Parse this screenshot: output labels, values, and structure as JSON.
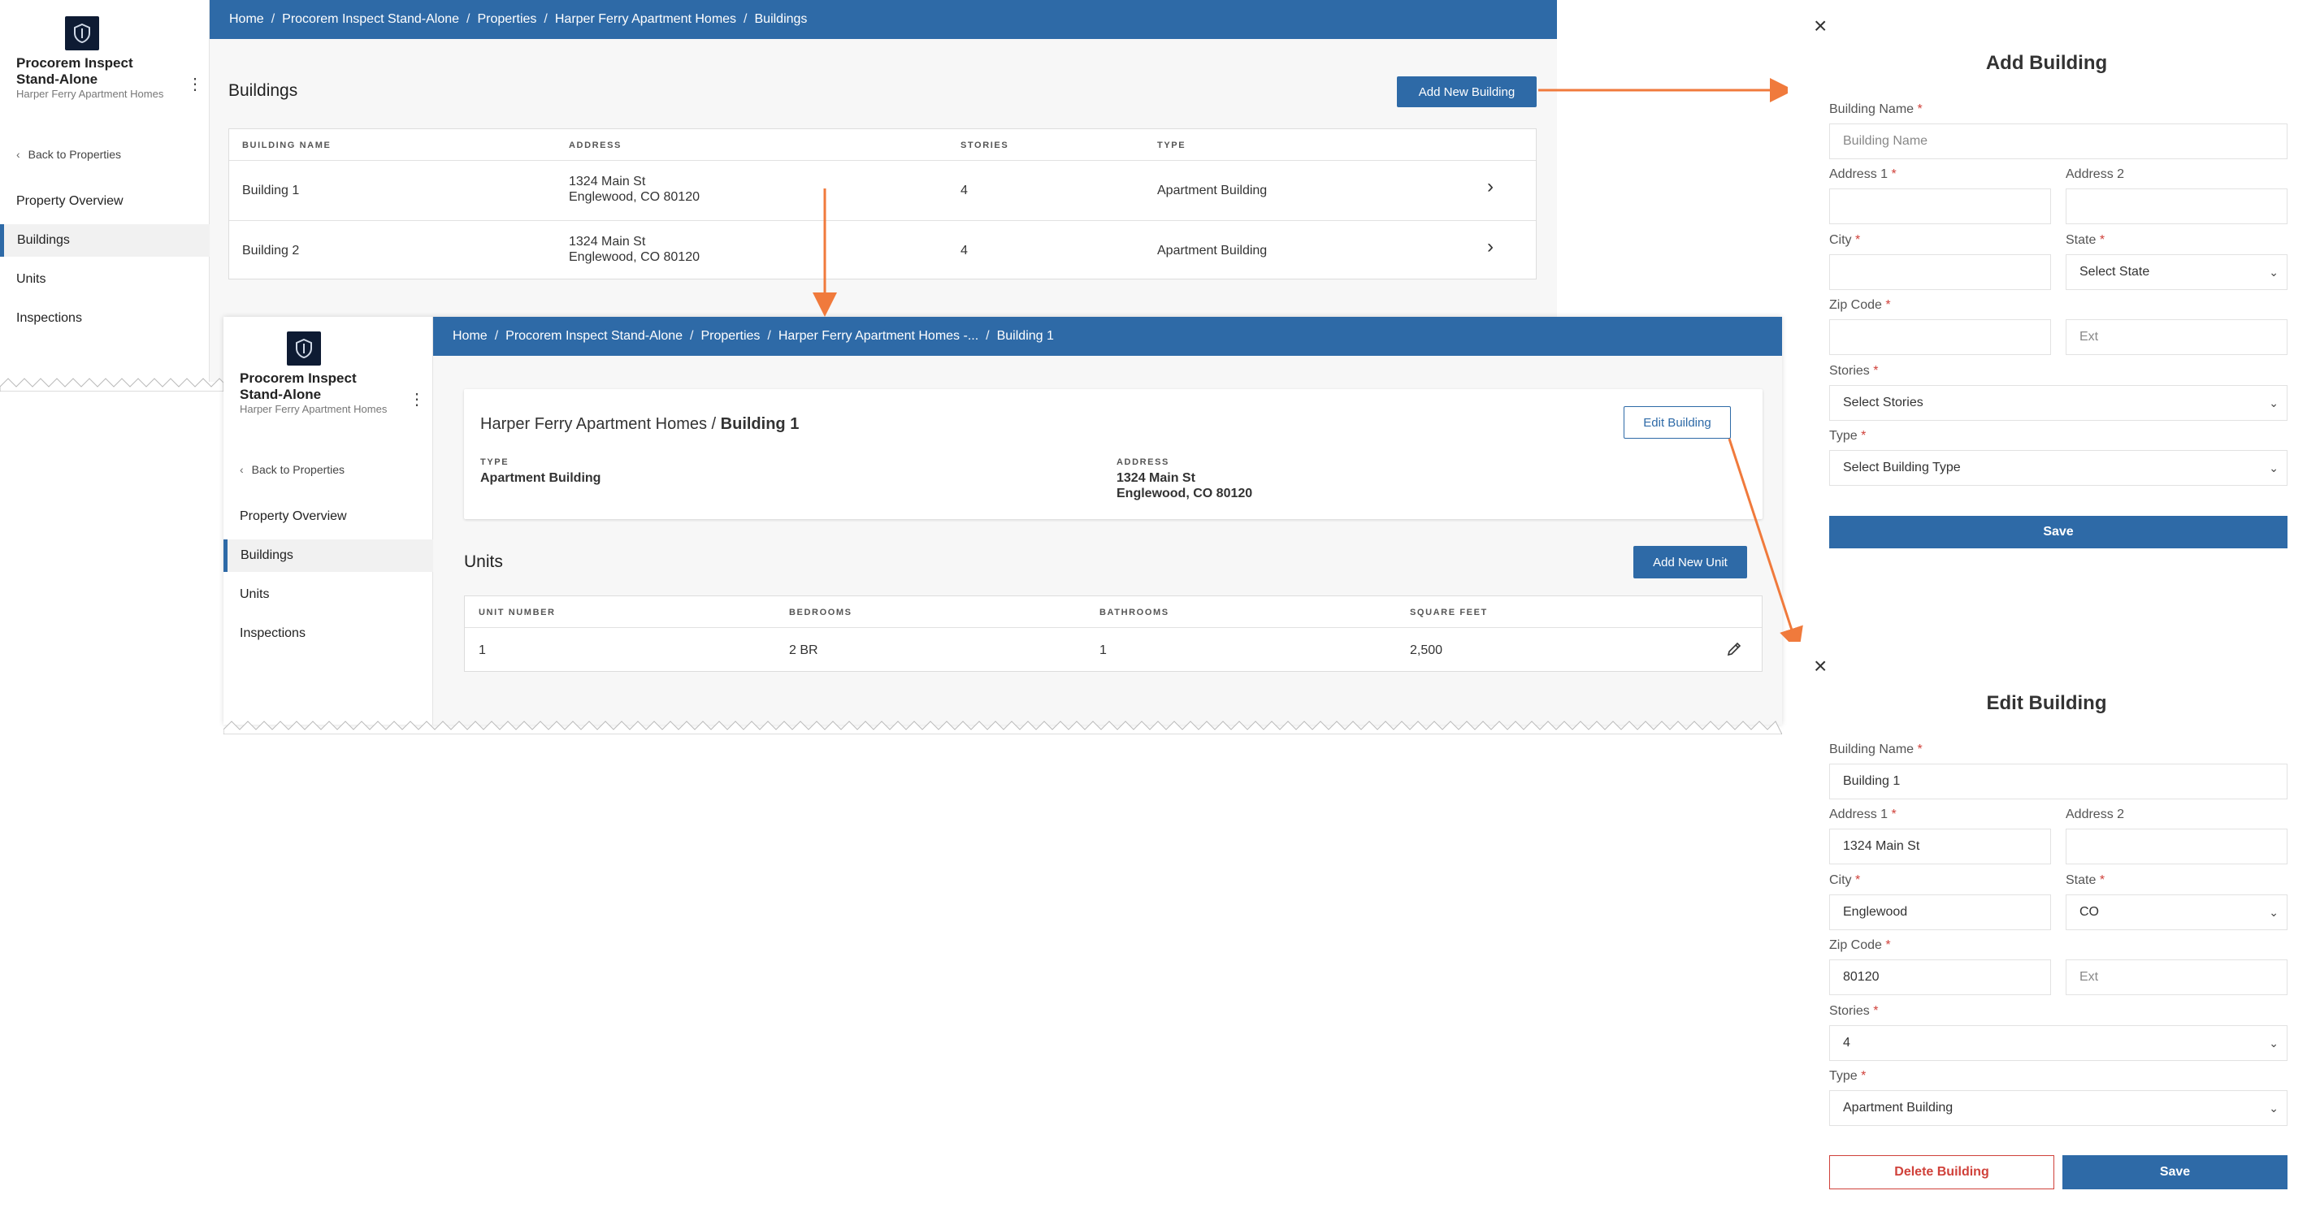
{
  "app": {
    "title": "Procorem Inspect Stand-Alone",
    "subtitle": "Harper Ferry Apartment Homes"
  },
  "sidebar": {
    "back_label": "Back to Properties",
    "items": [
      {
        "label": "Property Overview",
        "active": false
      },
      {
        "label": "Buildings",
        "active": true
      },
      {
        "label": "Units",
        "active": false
      },
      {
        "label": "Inspections",
        "active": false
      }
    ]
  },
  "buildings_page": {
    "breadcrumb": [
      "Home",
      "Procorem Inspect Stand-Alone",
      "Properties",
      "Harper Ferry Apartment Homes",
      "Buildings"
    ],
    "heading": "Buildings",
    "add_button": "Add New Building",
    "columns": [
      "BUILDING NAME",
      "ADDRESS",
      "STORIES",
      "TYPE"
    ],
    "rows": [
      {
        "name": "Building 1",
        "address1": "1324 Main St",
        "address2": "Englewood, CO 80120",
        "stories": "4",
        "type": "Apartment Building"
      },
      {
        "name": "Building 2",
        "address1": "1324 Main St",
        "address2": "Englewood, CO 80120",
        "stories": "4",
        "type": "Apartment Building"
      }
    ]
  },
  "building_detail": {
    "breadcrumb": [
      "Home",
      "Procorem Inspect Stand-Alone",
      "Properties",
      "Harper Ferry Apartment Homes -...",
      "Building 1"
    ],
    "card_title_prefix": "Harper Ferry Apartment Homes /",
    "card_title_bold": "Building 1",
    "edit_button": "Edit Building",
    "type_label": "TYPE",
    "type_value": "Apartment Building",
    "address_label": "ADDRESS",
    "address_line1": "1324 Main St",
    "address_line2": "Englewood, CO 80120",
    "units_heading": "Units",
    "add_unit_button": "Add New Unit",
    "unit_columns": [
      "UNIT NUMBER",
      "BEDROOMS",
      "BATHROOMS",
      "SQUARE FEET"
    ],
    "unit_rows": [
      {
        "number": "1",
        "bedrooms": "2 BR",
        "bathrooms": "1",
        "sqft": "2,500"
      }
    ]
  },
  "add_modal": {
    "title": "Add Building",
    "building_name_label": "Building Name",
    "building_name_placeholder": "Building Name",
    "address1_label": "Address 1",
    "address2_label": "Address 2",
    "city_label": "City",
    "state_label": "State",
    "state_value": "Select State",
    "zip_label": "Zip Code",
    "ext_placeholder": "Ext",
    "stories_label": "Stories",
    "stories_value": "Select Stories",
    "type_label": "Type",
    "type_value": "Select Building Type",
    "save_label": "Save",
    "required_mark": "*"
  },
  "edit_modal": {
    "title": "Edit Building",
    "building_name_label": "Building Name",
    "building_name_value": "Building 1",
    "address1_label": "Address 1",
    "address1_value": "1324 Main St",
    "address2_label": "Address 2",
    "city_label": "City",
    "city_value": "Englewood",
    "state_label": "State",
    "state_value": "CO",
    "zip_label": "Zip Code",
    "zip_value": "80120",
    "ext_placeholder": "Ext",
    "stories_label": "Stories",
    "stories_value": "4",
    "type_label": "Type",
    "type_value": "Apartment Building",
    "delete_label": "Delete Building",
    "save_label": "Save",
    "required_mark": "*"
  },
  "colors": {
    "primary": "#2e6aa7",
    "danger": "#d0413a",
    "arrow": "#f07a3c",
    "logo_bg": "#0e1b33"
  },
  "icons": {
    "close": "close-icon",
    "chevron": "chevron-right-icon",
    "pencil": "pencil-icon",
    "kebab": "kebab-menu-icon",
    "back": "chevron-left-icon"
  }
}
